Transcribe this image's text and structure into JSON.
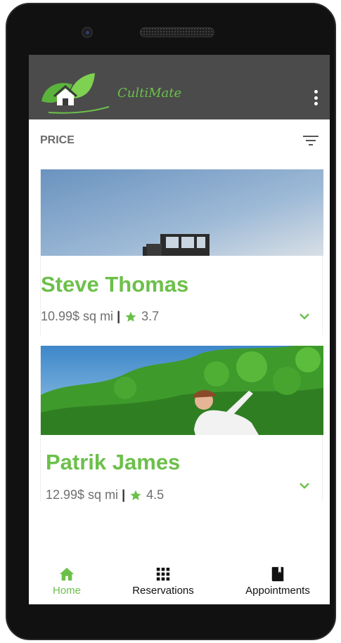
{
  "app": {
    "title": "CultiMate"
  },
  "sort": {
    "label": "PRICE"
  },
  "cards": [
    {
      "name": "Steve Thomas",
      "price": "10.99$ sq mi",
      "separator": "|",
      "rating": "3.7"
    },
    {
      "name": "Patrik James",
      "price": "12.99$ sq mi",
      "separator": "|",
      "rating": "4.5"
    }
  ],
  "bottom_nav": {
    "items": [
      {
        "label": "Home",
        "icon": "home-icon",
        "active": true
      },
      {
        "label": "Reservations",
        "icon": "grid-icon",
        "active": false
      },
      {
        "label": "Appointments",
        "icon": "book-icon",
        "active": false
      }
    ]
  },
  "colors": {
    "accent": "#6cc04a",
    "appbar": "#4b4b4b",
    "bezel": "#111111"
  }
}
